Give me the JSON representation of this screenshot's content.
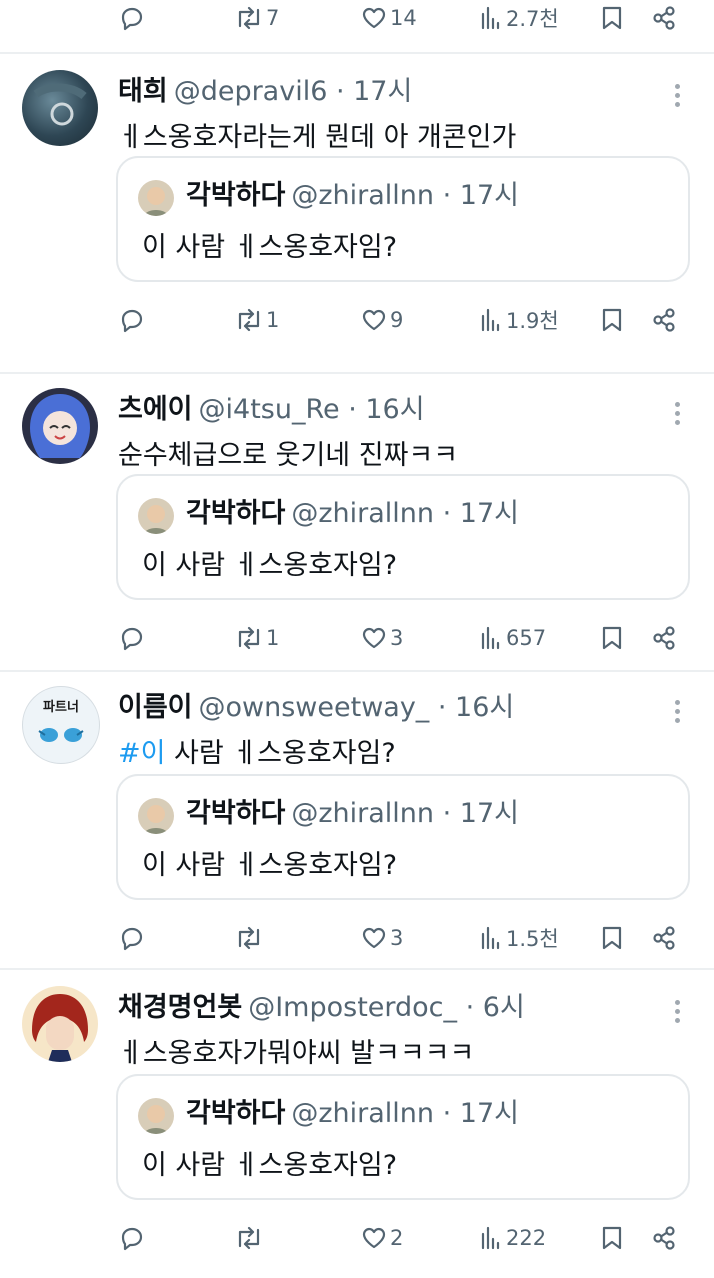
{
  "top_actions": {
    "retweets": "7",
    "likes": "14",
    "views": "2.7천"
  },
  "quoted": {
    "name": "각박하다",
    "handle": "@zhirallnn · 17시",
    "text": "이 사람 ㅔ스옹호자임?"
  },
  "tweets": [
    {
      "name": "태희",
      "handle": "@depravil6 · 17시",
      "text": "ㅔ스옹호자라는게 뭔데 아 개콘인가",
      "replies": "",
      "retweets": "1",
      "likes": "9",
      "views": "1.9천"
    },
    {
      "name": "츠에이",
      "handle": "@i4tsu_Re · 16시",
      "text": "순수체급으로 웃기네 진짜ㅋㅋ",
      "replies": "",
      "retweets": "1",
      "likes": "3",
      "views": "657"
    },
    {
      "name": "이름이",
      "handle": "@ownsweetway_ · 16시",
      "hashtag": "#이",
      "text": " 사람 ㅔ스옹호자임?",
      "replies": "",
      "retweets": "",
      "likes": "3",
      "views": "1.5천",
      "avatar_text": "파트너"
    },
    {
      "name": "채경명언봇",
      "handle": "@Imposterdoc_ · 6시",
      "text": "ㅔ스옹호자가뭐야씨 발ㅋㅋㅋㅋ",
      "replies": "",
      "retweets": "",
      "likes": "2",
      "views": "222"
    }
  ],
  "colors": {
    "accent": "#1d9bf0",
    "muted": "#536471",
    "border": "#e4e8eb"
  }
}
